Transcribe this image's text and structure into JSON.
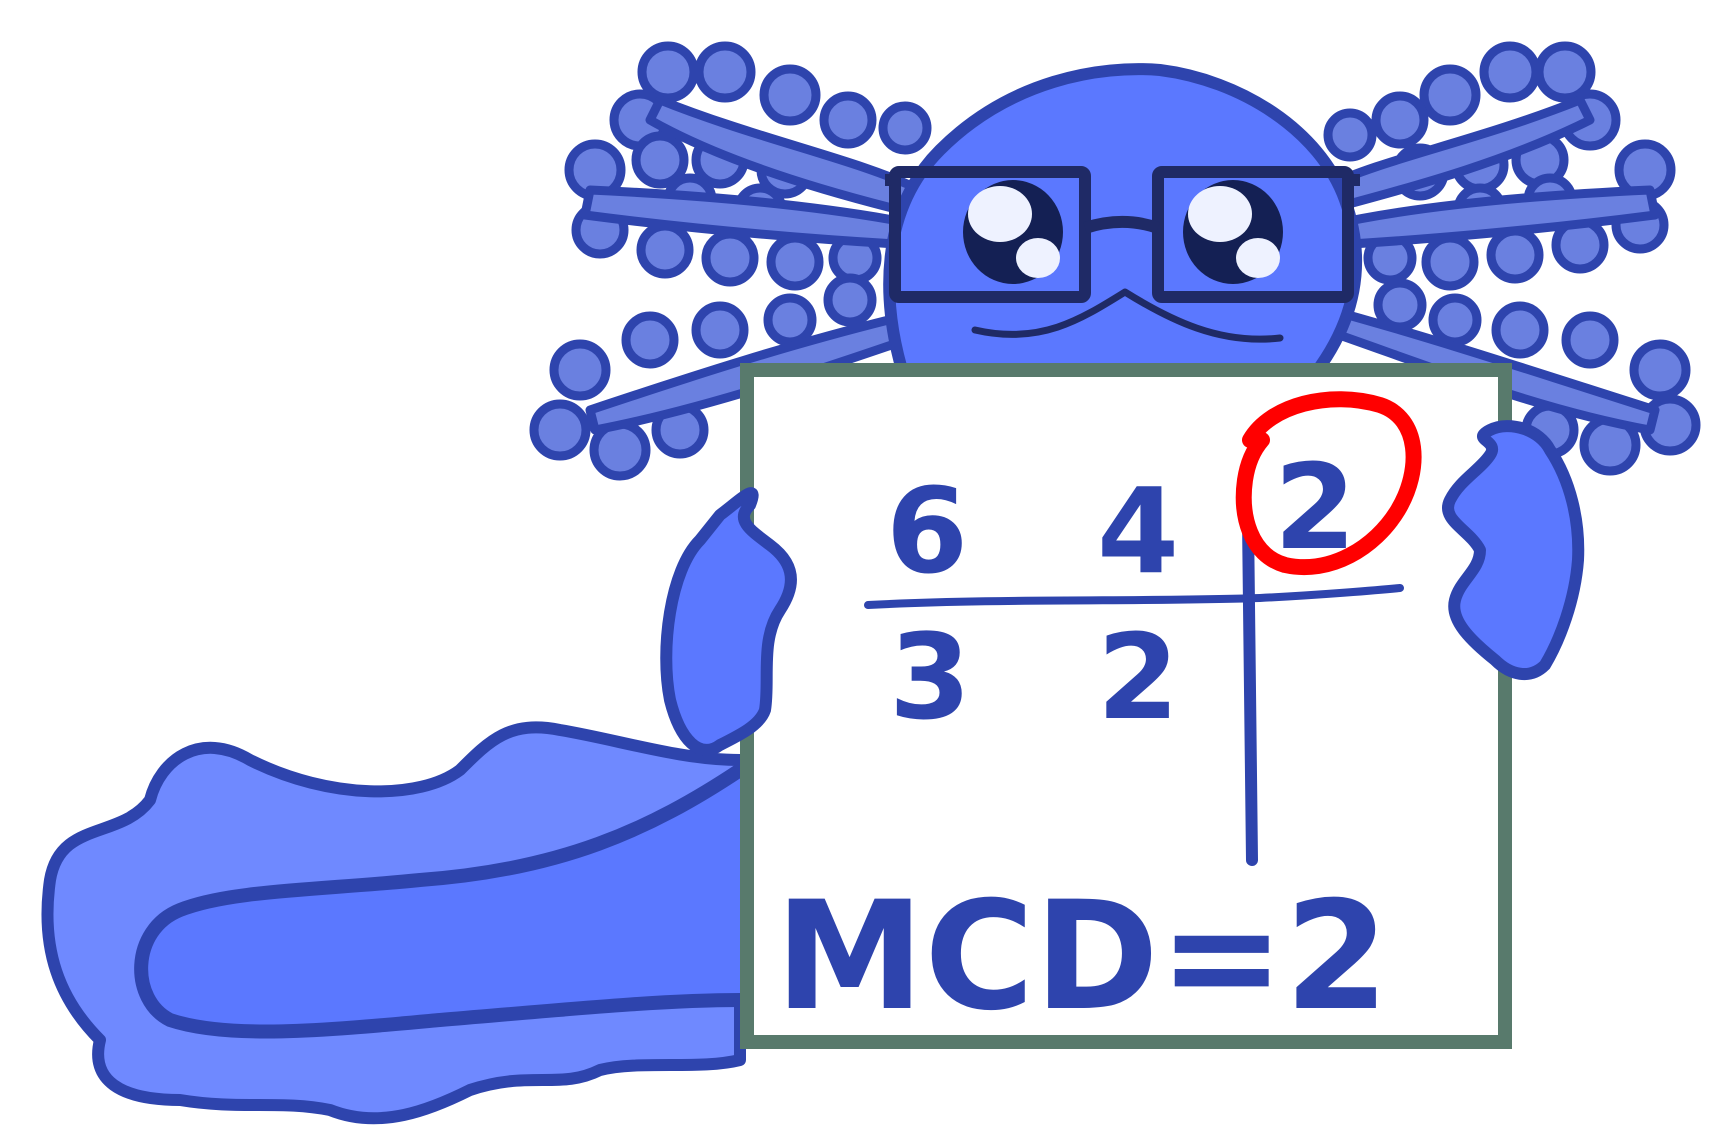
{
  "board": {
    "top_numbers": [
      "6",
      "4"
    ],
    "divisor": "2",
    "bottom_numbers": [
      "3",
      "2"
    ],
    "result_label": "MCD=2"
  },
  "colors": {
    "outline": "#2e44ad",
    "body": "#5b78ff",
    "gills": "#6a80e0",
    "tail": "#6f89ff",
    "board_frame": "#587a6c",
    "board_fill": "#ffffff",
    "highlight": "#ff0000",
    "glasses": "#1f2a66"
  }
}
